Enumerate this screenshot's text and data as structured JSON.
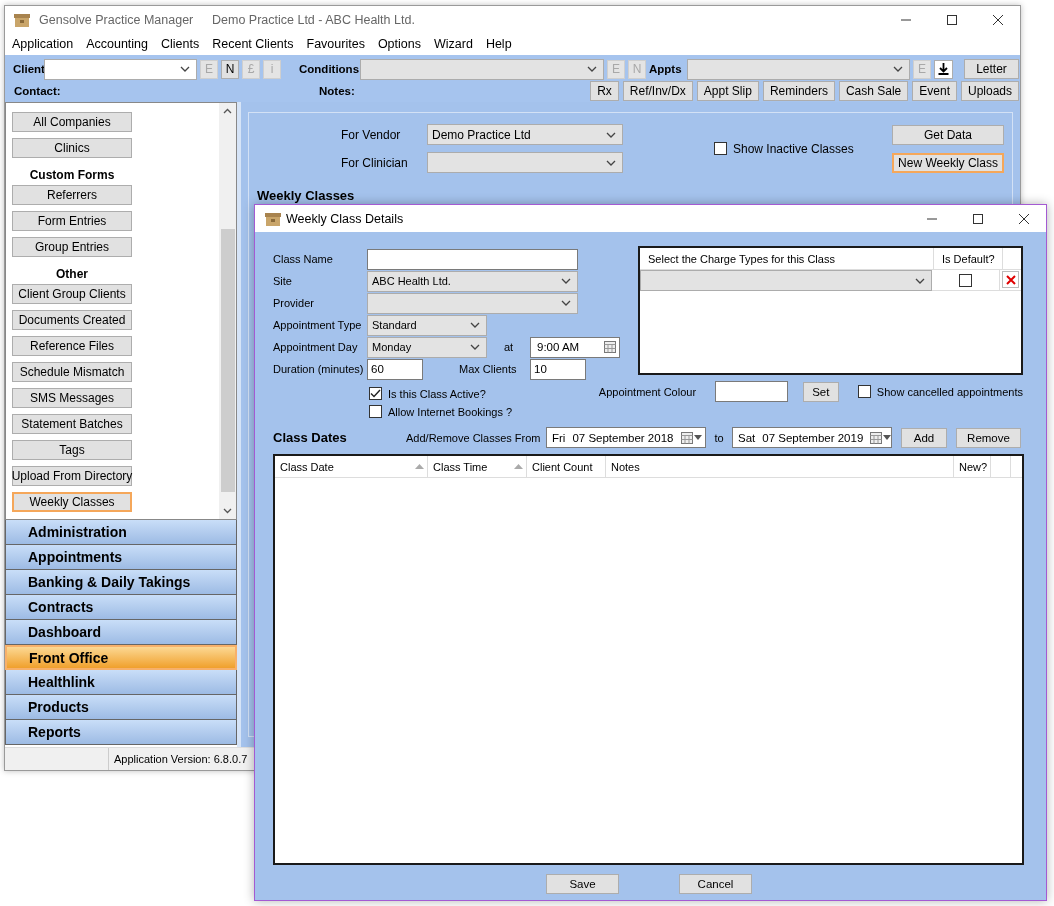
{
  "app": {
    "title": "Gensolve Practice Manager",
    "subtitle": "Demo Practice Ltd  - ABC Health Ltd."
  },
  "menu": [
    "Application",
    "Accounting",
    "Clients",
    "Recent Clients",
    "Favourites",
    "Options",
    "Wizard",
    "Help"
  ],
  "toolbar": {
    "client": {
      "label": "Client"
    },
    "client_buttons": [
      {
        "label": "E",
        "disabled": true
      },
      {
        "label": "N",
        "disabled": false
      },
      {
        "label": "£",
        "disabled": true
      },
      {
        "label": "i",
        "disabled": true
      }
    ],
    "conditions": {
      "label": "Conditions"
    },
    "conditions_buttons": [
      {
        "label": "E",
        "disabled": true
      },
      {
        "label": "N",
        "disabled": true
      }
    ],
    "appts": {
      "label": "Appts"
    },
    "appts_buttons": [
      {
        "kind": "text",
        "label": "E",
        "disabled": true
      },
      {
        "kind": "download",
        "disabled": false
      }
    ],
    "letter": "Letter",
    "contact_label": "Contact:",
    "notes_label": "Notes:",
    "actions": [
      "Rx",
      "Ref/Inv/Dx",
      "Appt Slip",
      "Reminders",
      "Cash Sale",
      "Event",
      "Uploads"
    ]
  },
  "sidebar": {
    "items": [
      {
        "kind": "button",
        "label": "All Companies",
        "selected": false
      },
      {
        "kind": "button",
        "label": "Clinics",
        "selected": false
      },
      {
        "kind": "heading",
        "label": "Custom Forms"
      },
      {
        "kind": "button",
        "label": "Referrers",
        "selected": false
      },
      {
        "kind": "button",
        "label": "Form Entries",
        "selected": false
      },
      {
        "kind": "button",
        "label": "Group Entries",
        "selected": false
      },
      {
        "kind": "heading",
        "label": "Other"
      },
      {
        "kind": "button",
        "label": "Client Group Clients",
        "selected": false
      },
      {
        "kind": "button",
        "label": "Documents Created",
        "selected": false
      },
      {
        "kind": "button",
        "label": "Reference Files",
        "selected": false
      },
      {
        "kind": "button",
        "label": "Schedule Mismatch",
        "selected": false
      },
      {
        "kind": "button",
        "label": "SMS Messages",
        "selected": false
      },
      {
        "kind": "button",
        "label": "Statement Batches",
        "selected": false
      },
      {
        "kind": "button",
        "label": "Tags",
        "selected": false
      },
      {
        "kind": "button",
        "label": "Upload From Directory",
        "selected": false
      },
      {
        "kind": "button",
        "label": "Weekly Classes",
        "selected": true
      }
    ],
    "nav": [
      {
        "label": "Administration",
        "selected": false
      },
      {
        "label": "Appointments",
        "selected": false
      },
      {
        "label": "Banking & Daily Takings",
        "selected": false
      },
      {
        "label": "Contracts",
        "selected": false
      },
      {
        "label": "Dashboard",
        "selected": false
      },
      {
        "label": "Front Office",
        "selected": true
      },
      {
        "label": "Healthlink",
        "selected": false
      },
      {
        "label": "Products",
        "selected": false
      },
      {
        "label": "Reports",
        "selected": false
      }
    ]
  },
  "status_bar": {
    "version": "Application Version: 6.8.0.7"
  },
  "content": {
    "vendor": {
      "label": "For Vendor",
      "value": "Demo Practice Ltd"
    },
    "clinician": {
      "label": "For Clinician"
    },
    "show_inactive": {
      "label": "Show Inactive Classes",
      "checked": false
    },
    "buttons": [
      {
        "label": "Get Data",
        "focused": false
      },
      {
        "label": "New Weekly Class",
        "focused": true
      }
    ],
    "heading": "Weekly Classes"
  },
  "dialog": {
    "title": "Weekly Class Details",
    "class_name": {
      "label": "Class Name"
    },
    "site": {
      "label": "Site",
      "value": "ABC Health Ltd."
    },
    "provider": {
      "label": "Provider"
    },
    "appointment_type": {
      "label": "Appointment Type",
      "value": "Standard"
    },
    "appointment_day": {
      "label": "Appointment Day",
      "value": "Monday"
    },
    "at_label": "at",
    "time": "9:00 AM",
    "duration": {
      "label": "Duration (minutes)",
      "value": "60"
    },
    "max_clients": {
      "label": "Max Clients",
      "value": "10"
    },
    "checkboxes": [
      {
        "label": "Is this Class Active?",
        "checked": true
      },
      {
        "label": "Allow Internet Bookings ?",
        "checked": false
      }
    ],
    "charge_grid": {
      "columns": [
        "Select the Charge Types for this Class",
        "Is Default?"
      ],
      "rows": [
        {
          "is_default": false
        }
      ]
    },
    "appointment_colour": {
      "label": "Appointment Colour"
    },
    "set_button": "Set",
    "show_cancelled": {
      "label": "Show cancelled appointments",
      "checked": false
    },
    "class_dates": {
      "heading": "Class Dates",
      "range_label": "Add/Remove Classes From",
      "from": {
        "day": "Fri",
        "date": "07 September 2018"
      },
      "to_label": "to",
      "to": {
        "day": "Sat",
        "date": "07 September 2019"
      },
      "buttons": [
        "Add",
        "Remove"
      ]
    },
    "table": {
      "columns": [
        {
          "label": "Class Date",
          "sortable": true
        },
        {
          "label": "Class Time",
          "sortable": true
        },
        {
          "label": "Client Count",
          "sortable": false
        },
        {
          "label": "Notes",
          "sortable": false
        },
        {
          "label": "New?",
          "sortable": false
        }
      ]
    },
    "footer_buttons": [
      "Save",
      "Cancel"
    ]
  }
}
